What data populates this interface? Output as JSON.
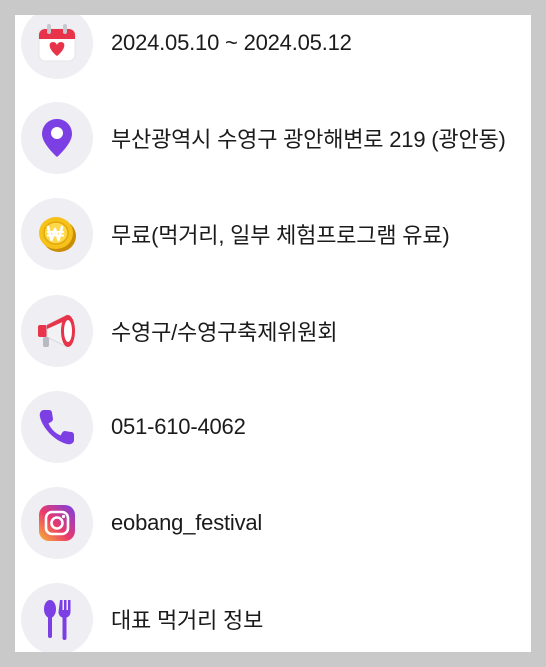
{
  "info_list": {
    "items": [
      {
        "icon": "calendar-heart-icon",
        "text": "2024.05.10 ~ 2024.05.12"
      },
      {
        "icon": "location-pin-icon",
        "text": "부산광역시 수영구 광안해변로 219 (광안동)"
      },
      {
        "icon": "won-coin-icon",
        "text": "무료(먹거리, 일부 체험프로그램 유료)"
      },
      {
        "icon": "megaphone-icon",
        "text": "수영구/수영구축제위원회"
      },
      {
        "icon": "phone-icon",
        "text": "051-610-4062"
      },
      {
        "icon": "instagram-icon",
        "text": "eobang_festival"
      },
      {
        "icon": "spoon-fork-icon",
        "text": "대표 먹거리 정보"
      }
    ]
  },
  "colors": {
    "page_background": "#c9c9c9",
    "card_background": "#ffffff",
    "icon_circle": "#eeeef3",
    "text": "#1b1b1b",
    "purple_accent": "#7b3fe4",
    "calendar_red": "#e8344a",
    "coin_gold": "#f6c21a"
  }
}
